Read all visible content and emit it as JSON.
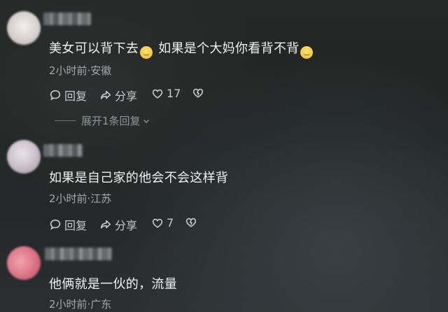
{
  "comments": [
    {
      "text_part1": "美女可以背下去",
      "text_part2": "如果是个大妈你看背不背",
      "emoji": "😅",
      "meta": "2小时前·安徽",
      "reply_label": "回复",
      "share_label": "分享",
      "like_count": "17"
    },
    {
      "text": "如果是自己家的他会不会这样背",
      "meta": "2小时前·江苏",
      "reply_label": "回复",
      "share_label": "分享",
      "like_count": "7"
    },
    {
      "text": "他俩就是一伙的，流量",
      "meta": "2小时前·广东"
    }
  ],
  "expand_replies": "展开1条回复",
  "icons": {
    "reply": "comment-bubble-icon",
    "share": "share-arrow-icon",
    "like": "heart-icon",
    "dislike": "broken-heart-icon",
    "expand": "chevron-down-icon"
  },
  "colors": {
    "text": "#f2f2f2",
    "meta": "#a4a8aa",
    "action": "#c7cacc"
  }
}
